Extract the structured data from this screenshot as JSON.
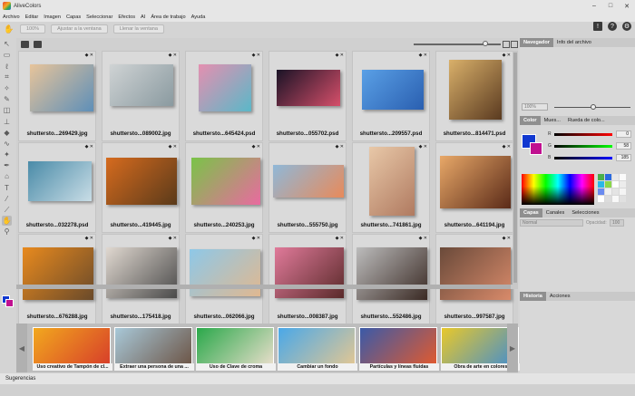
{
  "app": {
    "title": "AliveColors",
    "close_glyph": "✕"
  },
  "menu": [
    "Archivo",
    "Editar",
    "Imagen",
    "Capas",
    "Seleccionar",
    "Efectos",
    "AI",
    "Área de trabajo",
    "Ayuda"
  ],
  "toolbar": {
    "zoom_value": "100%",
    "fit_label": "Ajustar a la ventana",
    "fill_label": "Llenar la ventana"
  },
  "files": [
    {
      "name": "shuttersto...269429.jpg",
      "c1": "#e7c49a",
      "c2": "#5e8fb8"
    },
    {
      "name": "shuttersto...089002.jpg",
      "c1": "#cfd3d4",
      "c2": "#8a9aa0"
    },
    {
      "name": "shuttersto...645424.psd",
      "c1": "#e58fb0",
      "c2": "#5ab8c8"
    },
    {
      "name": "shuttersto...055702.psd",
      "c1": "#1a1326",
      "c2": "#d64f6a"
    },
    {
      "name": "shuttersto...209557.psd",
      "c1": "#5aa0e6",
      "c2": "#2a5fb0"
    },
    {
      "name": "shuttersto...814471.psd",
      "c1": "#d9b06a",
      "c2": "#5a3a20"
    },
    {
      "name": "shuttersto...032278.psd",
      "c1": "#4a8ba8",
      "c2": "#c9dde6"
    },
    {
      "name": "shuttersto...419445.jpg",
      "c1": "#d66b1e",
      "c2": "#5a3a1a"
    },
    {
      "name": "shuttersto...240253.jpg",
      "c1": "#79c447",
      "c2": "#e96aa0"
    },
    {
      "name": "shuttersto...555750.jpg",
      "c1": "#8fb8d8",
      "c2": "#e88a5a"
    },
    {
      "name": "shuttersto...741861.jpg",
      "c1": "#e8c8a8",
      "c2": "#b07a60"
    },
    {
      "name": "shuttersto...641194.jpg",
      "c1": "#e8a868",
      "c2": "#5a2a18"
    },
    {
      "name": "shuttersto...676288.jpg",
      "c1": "#e88a1e",
      "c2": "#6a4a2a"
    },
    {
      "name": "shuttersto...175418.jpg",
      "c1": "#e0d8d0",
      "c2": "#4a4a4a"
    },
    {
      "name": "shuttersto...062066.jpg",
      "c1": "#8ec8e8",
      "c2": "#e0b890"
    },
    {
      "name": "shuttersto...008387.jpg",
      "c1": "#e07a9a",
      "c2": "#5a2a2a"
    },
    {
      "name": "shuttersto...552486.jpg",
      "c1": "#bcbcbc",
      "c2": "#3a2a24"
    },
    {
      "name": "shuttersto...997587.jpg",
      "c1": "#6a4a3a",
      "c2": "#d88a6a"
    }
  ],
  "tutorials": [
    {
      "label": "Uso creativo de Tampón de cl...",
      "c1": "#f2a81e",
      "c2": "#d63a2a"
    },
    {
      "label": "Extraer una persona de una ...",
      "c1": "#a8c8d8",
      "c2": "#6a5040"
    },
    {
      "label": "Uso de Clave de croma",
      "c1": "#2aa84a",
      "c2": "#f0e0d0"
    },
    {
      "label": "Cambiar un fondo",
      "c1": "#4aa8e8",
      "c2": "#e8c890"
    },
    {
      "label": "Partículas y líneas fluidas",
      "c1": "#3a5aa8",
      "c2": "#e85a2a"
    },
    {
      "label": "Obra de arte en colores",
      "c1": "#e8c82a",
      "c2": "#3a8ad8"
    }
  ],
  "suggestions_label": "Sugerencias",
  "panel": {
    "nav_tabs": [
      "Navegador",
      "Info del archivo"
    ],
    "nav_zoom": "100%",
    "color_tabs": [
      "Color",
      "Mues...",
      "Rueda de colo..."
    ],
    "rgb": {
      "r_label": "R",
      "g_label": "G",
      "b_label": "B",
      "r": "0",
      "g": "58",
      "b": "185"
    },
    "layers_tabs": [
      "Capas",
      "Canales",
      "Selecciones"
    ],
    "blend": "Normal",
    "opacity_label": "Opacidad:",
    "opacity": "100",
    "history_tabs": [
      "Historia",
      "Acciones"
    ]
  },
  "colors": {
    "fg": "#1138d0",
    "bg": "#c01090"
  }
}
